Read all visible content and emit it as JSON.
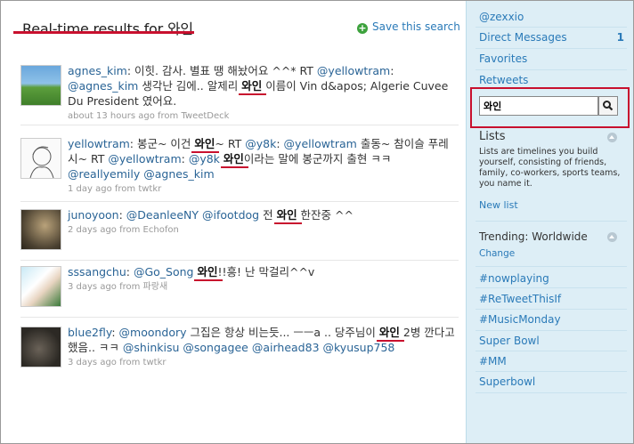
{
  "main": {
    "title": "Real-time results for 와인",
    "save_search": "Save this search"
  },
  "tweets": [
    {
      "user": "agnes_kim",
      "segments": [
        {
          "t": "text",
          "v": ": 이힛. 감사. 별표 땡 해놨어요 ^^* RT "
        },
        {
          "t": "link",
          "v": "@yellowtram"
        },
        {
          "t": "text",
          "v": ": "
        },
        {
          "t": "link",
          "v": "@agnes_kim"
        },
        {
          "t": "text",
          "v": " 생각난 김에.. 알제리 "
        },
        {
          "t": "kw",
          "v": "와인"
        },
        {
          "t": "text",
          "v": " 이름이 Vin d&apos; Algerie Cuvee Du President 였어요."
        }
      ],
      "meta": "about 13 hours ago from TweetDeck"
    },
    {
      "user": "yellowtram",
      "segments": [
        {
          "t": "text",
          "v": ": 봉군~ 이건 "
        },
        {
          "t": "kw",
          "v": "와인"
        },
        {
          "t": "text",
          "v": "~ RT "
        },
        {
          "t": "link",
          "v": "@y8k"
        },
        {
          "t": "text",
          "v": ": "
        },
        {
          "t": "link",
          "v": "@yellowtram"
        },
        {
          "t": "text",
          "v": " 출동~ 참이슬 푸레시~ RT "
        },
        {
          "t": "link",
          "v": "@yellowtram"
        },
        {
          "t": "text",
          "v": ": "
        },
        {
          "t": "link",
          "v": "@y8k"
        },
        {
          "t": "text",
          "v": " "
        },
        {
          "t": "kw",
          "v": "와인"
        },
        {
          "t": "text",
          "v": "이라는 말에 봉군까지 출현 ㅋㅋ "
        },
        {
          "t": "link",
          "v": "@reallyemily"
        },
        {
          "t": "text",
          "v": " "
        },
        {
          "t": "link",
          "v": "@agnes_kim"
        }
      ],
      "meta": "1 day ago from twtkr"
    },
    {
      "user": "junoyoon",
      "segments": [
        {
          "t": "text",
          "v": ": "
        },
        {
          "t": "link",
          "v": "@DeanleeNY"
        },
        {
          "t": "text",
          "v": " "
        },
        {
          "t": "link",
          "v": "@ifootdog"
        },
        {
          "t": "text",
          "v": " 전 "
        },
        {
          "t": "kw",
          "v": "와인"
        },
        {
          "t": "text",
          "v": " 한잔중 ^^"
        }
      ],
      "meta": "2 days ago from Echofon"
    },
    {
      "user": "sssangchu",
      "segments": [
        {
          "t": "text",
          "v": ": "
        },
        {
          "t": "link",
          "v": "@Go_Song"
        },
        {
          "t": "text",
          "v": " "
        },
        {
          "t": "kw",
          "v": "와인"
        },
        {
          "t": "text",
          "v": "!!흥! 난 막걸리^^v"
        }
      ],
      "meta": "3 days ago from 파랑새"
    },
    {
      "user": "blue2fly",
      "segments": [
        {
          "t": "text",
          "v": ": "
        },
        {
          "t": "link",
          "v": "@moondory"
        },
        {
          "t": "text",
          "v": " 그집은 항상 비는듯... ㅡㅡa .. 당주님이 "
        },
        {
          "t": "kw",
          "v": "와인"
        },
        {
          "t": "text",
          "v": " 2병 깐다고 했음.. ㅋㅋ "
        },
        {
          "t": "link",
          "v": "@shinkisu"
        },
        {
          "t": "text",
          "v": " "
        },
        {
          "t": "link",
          "v": "@songagee"
        },
        {
          "t": "text",
          "v": " "
        },
        {
          "t": "link",
          "v": "@airhead83"
        },
        {
          "t": "text",
          "v": " "
        },
        {
          "t": "link",
          "v": "@kyusup758"
        }
      ],
      "meta": "3 days ago from twtkr"
    }
  ],
  "sidebar": {
    "username": "@zexxio",
    "direct_messages": "Direct Messages",
    "dm_count": "1",
    "favorites": "Favorites",
    "retweets": "Retweets",
    "search_value": "와인",
    "lists_heading": "Lists",
    "lists_desc": "Lists are timelines you build yourself, consisting of friends, family, co-workers, sports teams, you name it.",
    "new_list": "New list",
    "trending_heading": "Trending: Worldwide",
    "change": "Change",
    "trends": [
      "#nowplaying",
      "#ReTweetThisIf",
      "#MusicMonday",
      "Super Bowl",
      "#MM",
      "Superbowl"
    ]
  },
  "colors": {
    "link": "#2a7ab8",
    "highlight": "#c8102e",
    "sidebar_bg": "#ddeef6"
  }
}
